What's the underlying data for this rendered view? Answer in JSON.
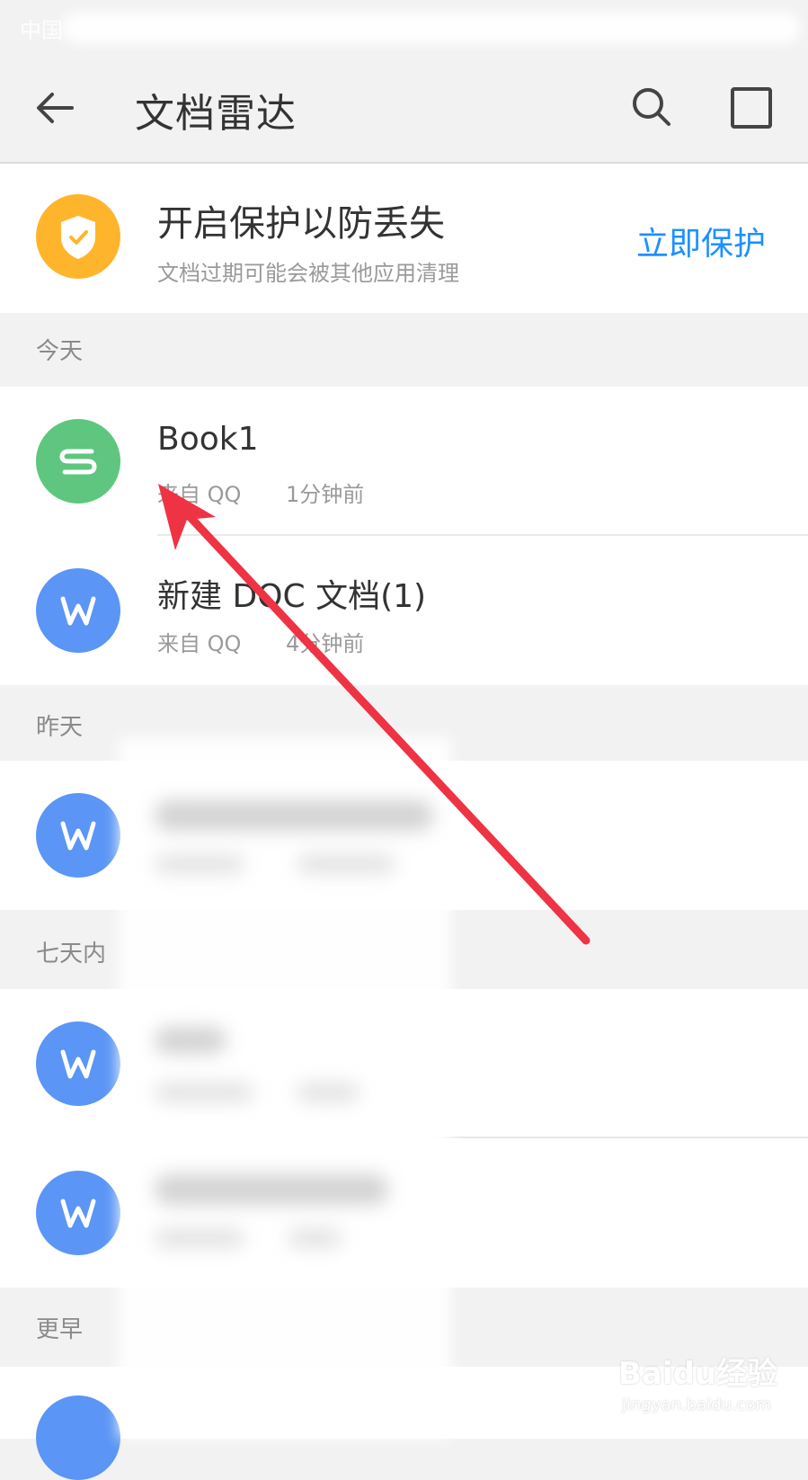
{
  "status_bar": {
    "carrier": "中国"
  },
  "app_bar": {
    "title": "文档雷达",
    "back_icon": "arrow-left-icon",
    "search_icon": "search-icon",
    "window_icon": "square-window-icon"
  },
  "protect_banner": {
    "icon": "shield-check-icon",
    "title": "开启保护以防丢失",
    "subtitle": "文档过期可能会被其他应用清理",
    "action_label": "立即保护",
    "accent_color": "#ffb52b",
    "action_color": "#1e90ff"
  },
  "sections": [
    {
      "label": "今天",
      "items": [
        {
          "name": "Book1",
          "source": "来自  QQ",
          "time": "1分钟前",
          "icon": "spreadsheet-s-icon",
          "color": "#5ec67f"
        },
        {
          "name": "新建 DOC 文档(1)",
          "source": "来自  QQ",
          "time": "4分钟前",
          "icon": "word-w-icon",
          "color": "#5b95f5"
        }
      ]
    },
    {
      "label": "昨天",
      "items": [
        {
          "icon": "word-w-icon",
          "color": "#5b95f5"
        }
      ]
    },
    {
      "label": "七天内",
      "items": [
        {
          "icon": "word-w-icon",
          "color": "#5b95f5"
        },
        {
          "icon": "word-w-icon",
          "color": "#5b95f5"
        }
      ]
    },
    {
      "label": "更早",
      "items": [
        {
          "icon": "word-w-icon",
          "color": "#5b95f5"
        }
      ]
    }
  ],
  "annotation": {
    "icon": "red-arrow-annotation",
    "color": "#ee3344"
  },
  "watermark": {
    "logo": "Baidu经验",
    "url": "jingyan.baidu.com"
  }
}
